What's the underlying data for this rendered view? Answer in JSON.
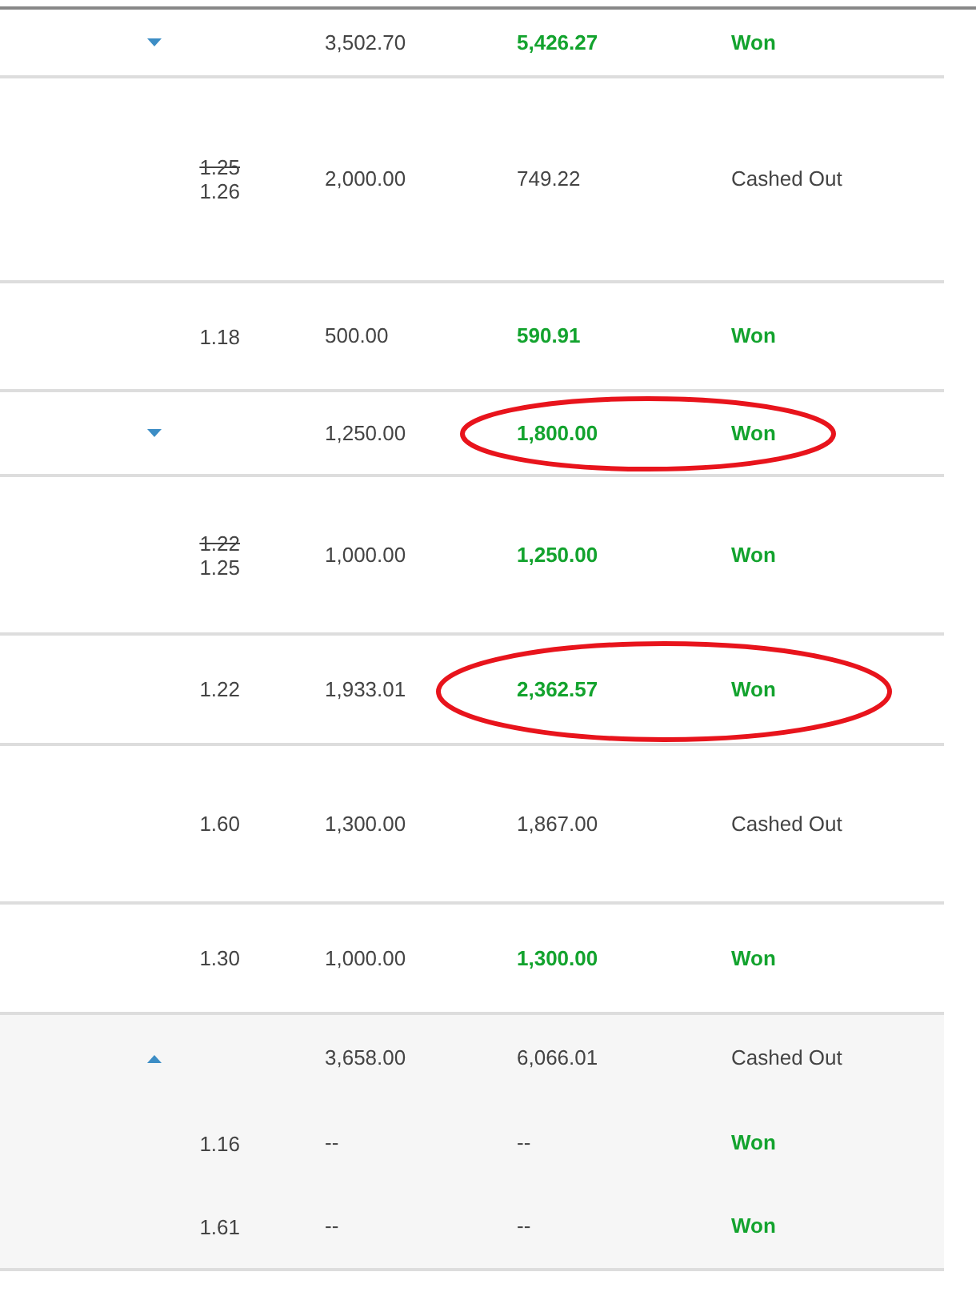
{
  "rows": [
    {
      "kind": "bet",
      "expanded": false,
      "stake": "3,502.70",
      "return": "5,426.27",
      "return_won": true,
      "status": "Won",
      "won": true
    },
    {
      "kind": "leg",
      "odds_old": "1.25",
      "odds": "1.26",
      "stake": "2,000.00",
      "return": "749.22",
      "return_won": false,
      "status": "Cashed Out",
      "won": false
    },
    {
      "kind": "leg",
      "odds": "1.18",
      "stake": "500.00",
      "return": "590.91",
      "return_won": true,
      "status": "Won",
      "won": true
    },
    {
      "kind": "bet",
      "expanded": false,
      "stake": "1,250.00",
      "return": "1,800.00",
      "return_won": true,
      "status": "Won",
      "won": true,
      "circled": true
    },
    {
      "kind": "leg",
      "odds_old": "1.22",
      "odds": "1.25",
      "stake": "1,000.00",
      "return": "1,250.00",
      "return_won": true,
      "status": "Won",
      "won": true
    },
    {
      "kind": "leg",
      "odds": "1.22",
      "stake": "1,933.01",
      "return": "2,362.57",
      "return_won": true,
      "status": "Won",
      "won": true,
      "circled": true
    },
    {
      "kind": "leg",
      "odds": "1.60",
      "stake": "1,300.00",
      "return": "1,867.00",
      "return_won": false,
      "status": "Cashed Out",
      "won": false
    },
    {
      "kind": "leg",
      "odds": "1.30",
      "stake": "1,000.00",
      "return": "1,300.00",
      "return_won": true,
      "status": "Won",
      "won": true
    },
    {
      "kind": "bet",
      "expanded": true,
      "stake": "3,658.00",
      "return": "6,066.01",
      "return_won": false,
      "status": "Cashed Out",
      "won": false,
      "legs": [
        {
          "odds": "1.16",
          "stake": "--",
          "return": "--",
          "return_won": false,
          "status": "Won",
          "won": true
        },
        {
          "odds": "1.61",
          "stake": "--",
          "return": "--",
          "return_won": false,
          "status": "Won",
          "won": true
        }
      ]
    }
  ]
}
